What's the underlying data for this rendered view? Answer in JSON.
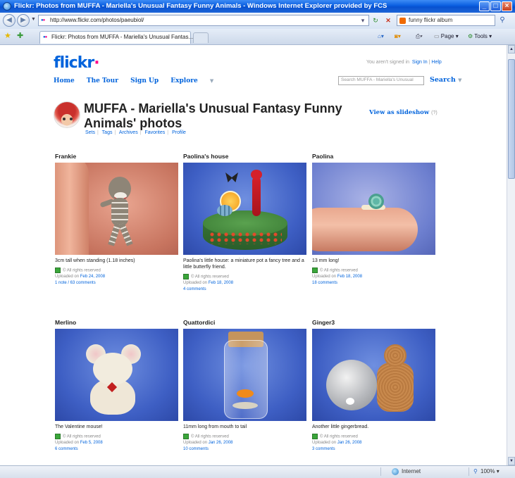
{
  "window": {
    "title": "Flickr: Photos from MUFFA - Mariella's Unusual Fantasy Funny Animals - Windows Internet Explorer provided by FCS",
    "url": "http://www.flickr.com/photos/paeubiol/",
    "search_query": "funny flickr album",
    "tab_label": "Flickr: Photos from MUFFA - Mariella's Unusual Fantas...",
    "commands": {
      "page": "Page",
      "tools": "Tools"
    },
    "status": {
      "zone": "Internet",
      "zoom": "100%"
    }
  },
  "site": {
    "logo_a": "flickr",
    "logo_b": "·",
    "signin_text": "You aren't signed in",
    "signin_link": "Sign In",
    "help_link": "Help",
    "nav": [
      "Home",
      "The Tour",
      "Sign Up",
      "Explore"
    ],
    "search_placeholder": "Search MUFFA - Mariella's Unusual",
    "search_button": "Search"
  },
  "profile": {
    "title": "MUFFA - Mariella's Unusual Fantasy Funny Animals' photos",
    "slideshow": "View as slideshow",
    "slideshow_help": "(?)",
    "subnav": [
      "Sets",
      "Tags",
      "Archives",
      "Favorites",
      "Profile"
    ]
  },
  "photos": [
    {
      "title": "Frankie",
      "desc": "3cm tall when standing (1.18 inches)",
      "license": "© All rights reserved",
      "uploaded_label": "Uploaded on",
      "uploaded_date": "Feb 24, 2008",
      "comments": "1 note / 63 comments"
    },
    {
      "title": "Paolina's house",
      "desc": "Paolina's little house: a miniature pot a fancy tree and a little butterfly friend.",
      "license": "© All rights reserved",
      "uploaded_label": "Uploaded on",
      "uploaded_date": "Feb 18, 2008",
      "comments": "4 comments"
    },
    {
      "title": "Paolina",
      "desc": "13 mm long!",
      "license": "© All rights reserved",
      "uploaded_label": "Uploaded on",
      "uploaded_date": "Feb 18, 2008",
      "comments": "18 comments"
    },
    {
      "title": "Merlino",
      "desc": "The Valentine mouse!",
      "license": "© All rights reserved",
      "uploaded_label": "Uploaded on",
      "uploaded_date": "Feb 5, 2008",
      "comments": "6 comments"
    },
    {
      "title": "Quattordici",
      "desc": "11mm long from mouth to tail",
      "license": "© All rights reserved",
      "uploaded_label": "Uploaded on",
      "uploaded_date": "Jan 26, 2008",
      "comments": "10 comments"
    },
    {
      "title": "Ginger3",
      "desc": "Another little gingerbread.",
      "license": "© All rights reserved",
      "uploaded_label": "Uploaded on",
      "uploaded_date": "Jan 26, 2008",
      "comments": "3 comments"
    }
  ]
}
